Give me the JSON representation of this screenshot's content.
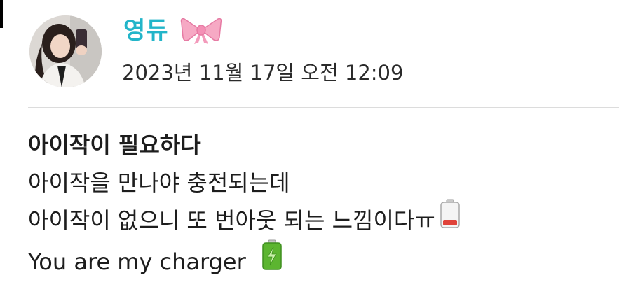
{
  "post": {
    "author": {
      "name": "영듀",
      "badge_icon": "pink-ribbon-icon",
      "avatar_icon": "profile-photo-avatar"
    },
    "timestamp": "2023년 11월 17일 오전 12:09",
    "lines": [
      "아이작이 필요하다",
      "아이작을 만나야 충전되는데",
      "아이작이 없으니 또 번아웃 되는 느낌이다ㅠ",
      "You are my charger"
    ],
    "emojis": {
      "low_battery": "low-battery-icon",
      "full_battery": "full-battery-icon"
    }
  },
  "colors": {
    "author_name": "#23b5c9",
    "text": "#1d1d1d",
    "divider": "#dcdcdc",
    "low_battery": "#e0433a",
    "full_battery": "#5cb530"
  }
}
